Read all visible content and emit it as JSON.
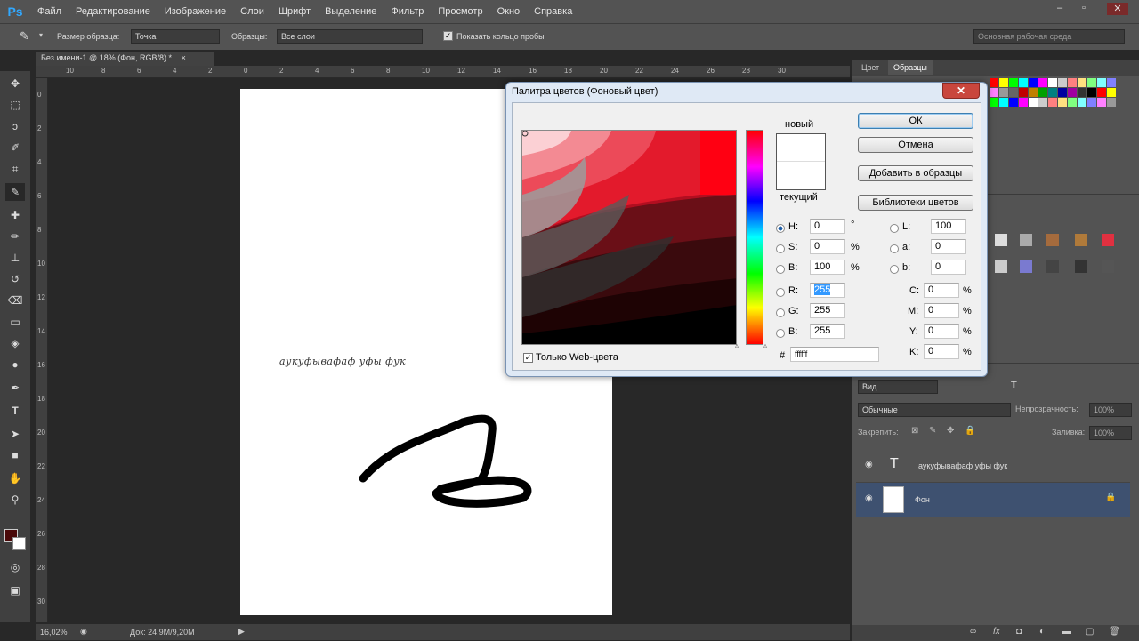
{
  "menu": {
    "logo": "Ps",
    "items": [
      "Файл",
      "Редактирование",
      "Изображение",
      "Слои",
      "Шрифт",
      "Выделение",
      "Фильтр",
      "Просмотр",
      "Окно",
      "Справка"
    ],
    "window_min": "–",
    "window_restore": "▫",
    "window_close": "✕"
  },
  "options": {
    "sample_size_label": "Размер образца:",
    "sample_size_value": "Точка",
    "samples_label": "Образцы:",
    "samples_value": "Все слои",
    "show_ring_label": "Показать кольцо пробы",
    "workspace": "Основная рабочая среда"
  },
  "document": {
    "tab_title": "Без имени-1 @ 18% (Фон, RGB/8) *",
    "tab_close": "×",
    "canvas_text": "аукуфывафаф уфы фук",
    "zoom": "16,02%",
    "doc_info": "Док: 24,9M/9,20M"
  },
  "ruler": {
    "h_ticks": [
      "10",
      "8",
      "6",
      "4",
      "2",
      "0",
      "2",
      "4",
      "6",
      "8",
      "10",
      "12",
      "14",
      "16",
      "18",
      "20",
      "22",
      "24",
      "26",
      "28",
      "30"
    ],
    "v_ticks": [
      "0",
      "2",
      "4",
      "6",
      "8",
      "10",
      "12",
      "14",
      "16",
      "18",
      "20",
      "22",
      "24",
      "26",
      "28",
      "30"
    ]
  },
  "dialog": {
    "title": "Палитра цветов (Фоновый цвет)",
    "close": "✕",
    "new_label": "новый",
    "current_label": "текущий",
    "ok": "ОК",
    "cancel": "Отмена",
    "add_swatch": "Добавить в образцы",
    "libraries": "Библиотеки цветов",
    "web_only": "Только Web-цвета",
    "web_only_check": "✓",
    "h_label": "H:",
    "h_value": "0",
    "h_unit": "°",
    "s_label": "S:",
    "s_value": "0",
    "s_unit": "%",
    "b_label": "B:",
    "b_value": "100",
    "b_unit": "%",
    "r_label": "R:",
    "r_value": "255",
    "g_label": "G:",
    "g_value": "255",
    "bl_label": "B:",
    "bl_value": "255",
    "l_label": "L:",
    "l_value": "100",
    "a_label": "a:",
    "a_value": "0",
    "b2_label": "b:",
    "b2_value": "0",
    "c_label": "C:",
    "c_value": "0",
    "c_unit": "%",
    "m_label": "M:",
    "m_value": "0",
    "m_unit": "%",
    "y_label": "Y:",
    "y_value": "0",
    "y_unit": "%",
    "k_label": "K:",
    "k_value": "0",
    "k_unit": "%",
    "hex_label": "#",
    "hex_value": "ffffff"
  },
  "panels": {
    "tab_color": "Цвет",
    "tab_swatches": "Образцы",
    "blend_mode": "Обычные",
    "opacity_label": "Непрозрачность:",
    "opacity_value": "100%",
    "lock_label": "Закрепить:",
    "fill_label": "Заливка:",
    "fill_value": "100%",
    "kind_filter": "Вид",
    "layers": [
      {
        "name": "аукуфывафаф уфы фук",
        "thumb": "T"
      },
      {
        "name": "Фон",
        "thumb": ""
      }
    ]
  },
  "colors": {
    "fg": "#4a0a0a",
    "bg": "#ffffff",
    "accent_blue": "#3399ff",
    "dialog_frame": "#dfe9f5"
  }
}
